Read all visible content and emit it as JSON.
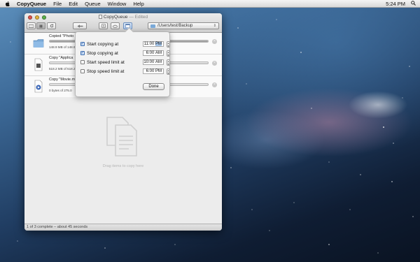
{
  "menubar": {
    "app_name": "CopyQueue",
    "items": [
      "File",
      "Edit",
      "Queue",
      "Window",
      "Help"
    ],
    "clock": "5:24 PM"
  },
  "window": {
    "title": "CopyQueue",
    "edited": "— Edited",
    "destination_path": "/Users/test/Backup",
    "status_bar": "1 of 3 complete – about 45 seconds",
    "drop_hint": "Drag items to copy here"
  },
  "queue": [
    {
      "title": "Copied \"Photo",
      "status": "148.9 MB of 148.9",
      "icon": "folder-icon",
      "progress": 1.0
    },
    {
      "title": "Copy \"Applica",
      "status": "518.2 MB of 518.2",
      "icon": "document-icon",
      "progress": 0.0
    },
    {
      "title": "Copy \"Movie.m",
      "status": "0 bytes of 275.0",
      "icon": "movie-file-icon",
      "progress": 0.0
    }
  ],
  "schedule": {
    "rows": [
      {
        "label": "Start copying at",
        "checked": true,
        "time": "11:00",
        "ampm": "PM",
        "selected": true
      },
      {
        "label": "Stop copying at",
        "checked": true,
        "time": "6:00",
        "ampm": "AM",
        "selected": false
      },
      {
        "label": "Start speed limit at",
        "checked": false,
        "time": "10:00",
        "ampm": "AM",
        "selected": false
      },
      {
        "label": "Stop speed limit at",
        "checked": false,
        "time": "6:00",
        "ampm": "PM",
        "selected": false
      }
    ],
    "done_label": "Done"
  }
}
